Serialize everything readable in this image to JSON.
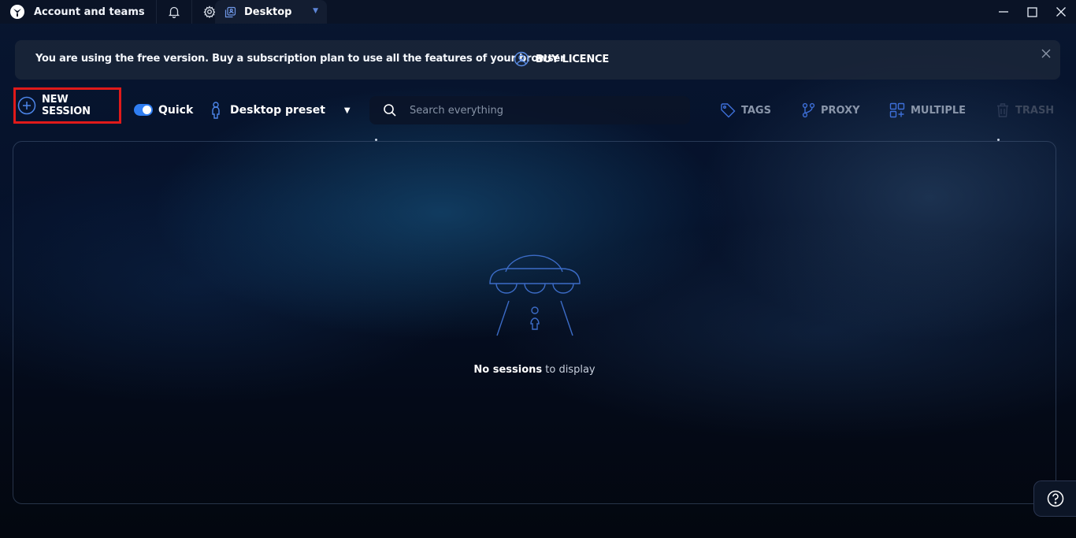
{
  "titlebar": {
    "account_label": "Account and teams",
    "tab_label": "Desktop",
    "icons": [
      "app-logo-icon",
      "bell-icon",
      "gear-icon",
      "desktop-tab-icon",
      "chevron-down-icon"
    ],
    "window_controls": [
      "minimize-icon",
      "maximize-icon",
      "close-icon"
    ]
  },
  "banner": {
    "message": "You are using the free version. Buy a subscription plan to use all the features of your browser",
    "buy_label": "BUY LICENCE",
    "icons": [
      "user-circle-icon",
      "close-icon"
    ]
  },
  "toolbar": {
    "new_session_label": "NEW SESSION",
    "quick_label": "Quick",
    "quick_enabled": true,
    "preset_label": "Desktop preset",
    "search_placeholder": "Search everything",
    "tags_label": "TAGS",
    "proxy_label": "PROXY",
    "multiple_label": "MULTIPLE",
    "trash_label": "TRASH",
    "icons": [
      "plus-circle-icon",
      "person-icon",
      "caret-down-icon",
      "search-icon",
      "tag-icon",
      "proxy-icon",
      "multiple-icon",
      "trash-icon"
    ]
  },
  "main": {
    "empty_primary": "No sessions",
    "empty_secondary": " to display",
    "illustration": "ufo-icon"
  },
  "help": {
    "icon": "help-icon"
  },
  "colors": {
    "accent": "#2f7df1",
    "highlight_border": "#e01a1a",
    "background": "#050c1a",
    "icon_blue": "#3d6fd8"
  }
}
